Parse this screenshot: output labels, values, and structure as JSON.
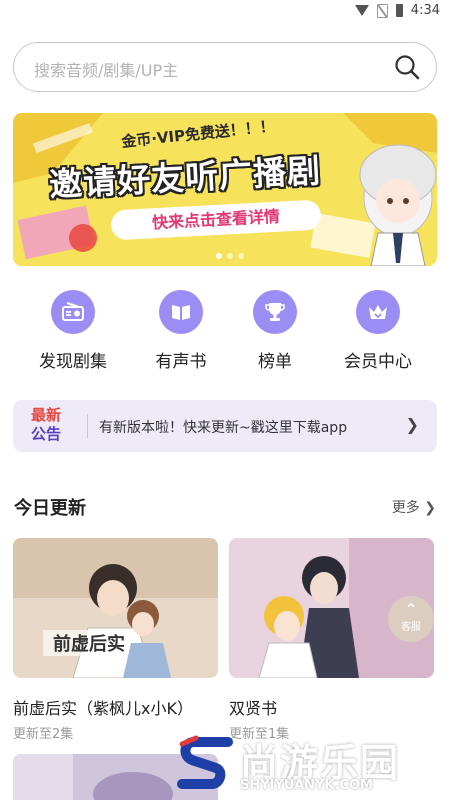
{
  "status_bar": {
    "time": "4:34"
  },
  "search": {
    "placeholder": "搜索音频/剧集/UP主"
  },
  "banner": {
    "line_small": "金币·VIP免费送！！！",
    "line_big": "邀请好友听广播剧",
    "cta": "快来点击查看详情"
  },
  "quick_menu": [
    {
      "label": "发现剧集",
      "icon": "radio-icon"
    },
    {
      "label": "有声书",
      "icon": "book-icon"
    },
    {
      "label": "榜单",
      "icon": "trophy-icon"
    },
    {
      "label": "会员中心",
      "icon": "crown-icon"
    }
  ],
  "notice": {
    "badge_line1": "最新",
    "badge_line2": "公告",
    "text": "有新版本啦！快来更新~戳这里下载app"
  },
  "today": {
    "title": "今日更新",
    "more": "更多"
  },
  "cards": [
    {
      "title": "前虚后实（紫枫儿x小K）",
      "subtitle": "更新至2集"
    },
    {
      "title": "双贤书",
      "subtitle": "更新至1集"
    }
  ],
  "service_button": {
    "label": "客服"
  },
  "watermark": {
    "title": "尚游乐园",
    "url": "SHYIYUANYK.COM"
  },
  "colors": {
    "accent": "#9a8ef5",
    "notice_bg": "#eeeaf8",
    "banner_bg": "#f7e25c",
    "cta_text": "#e03a73"
  }
}
